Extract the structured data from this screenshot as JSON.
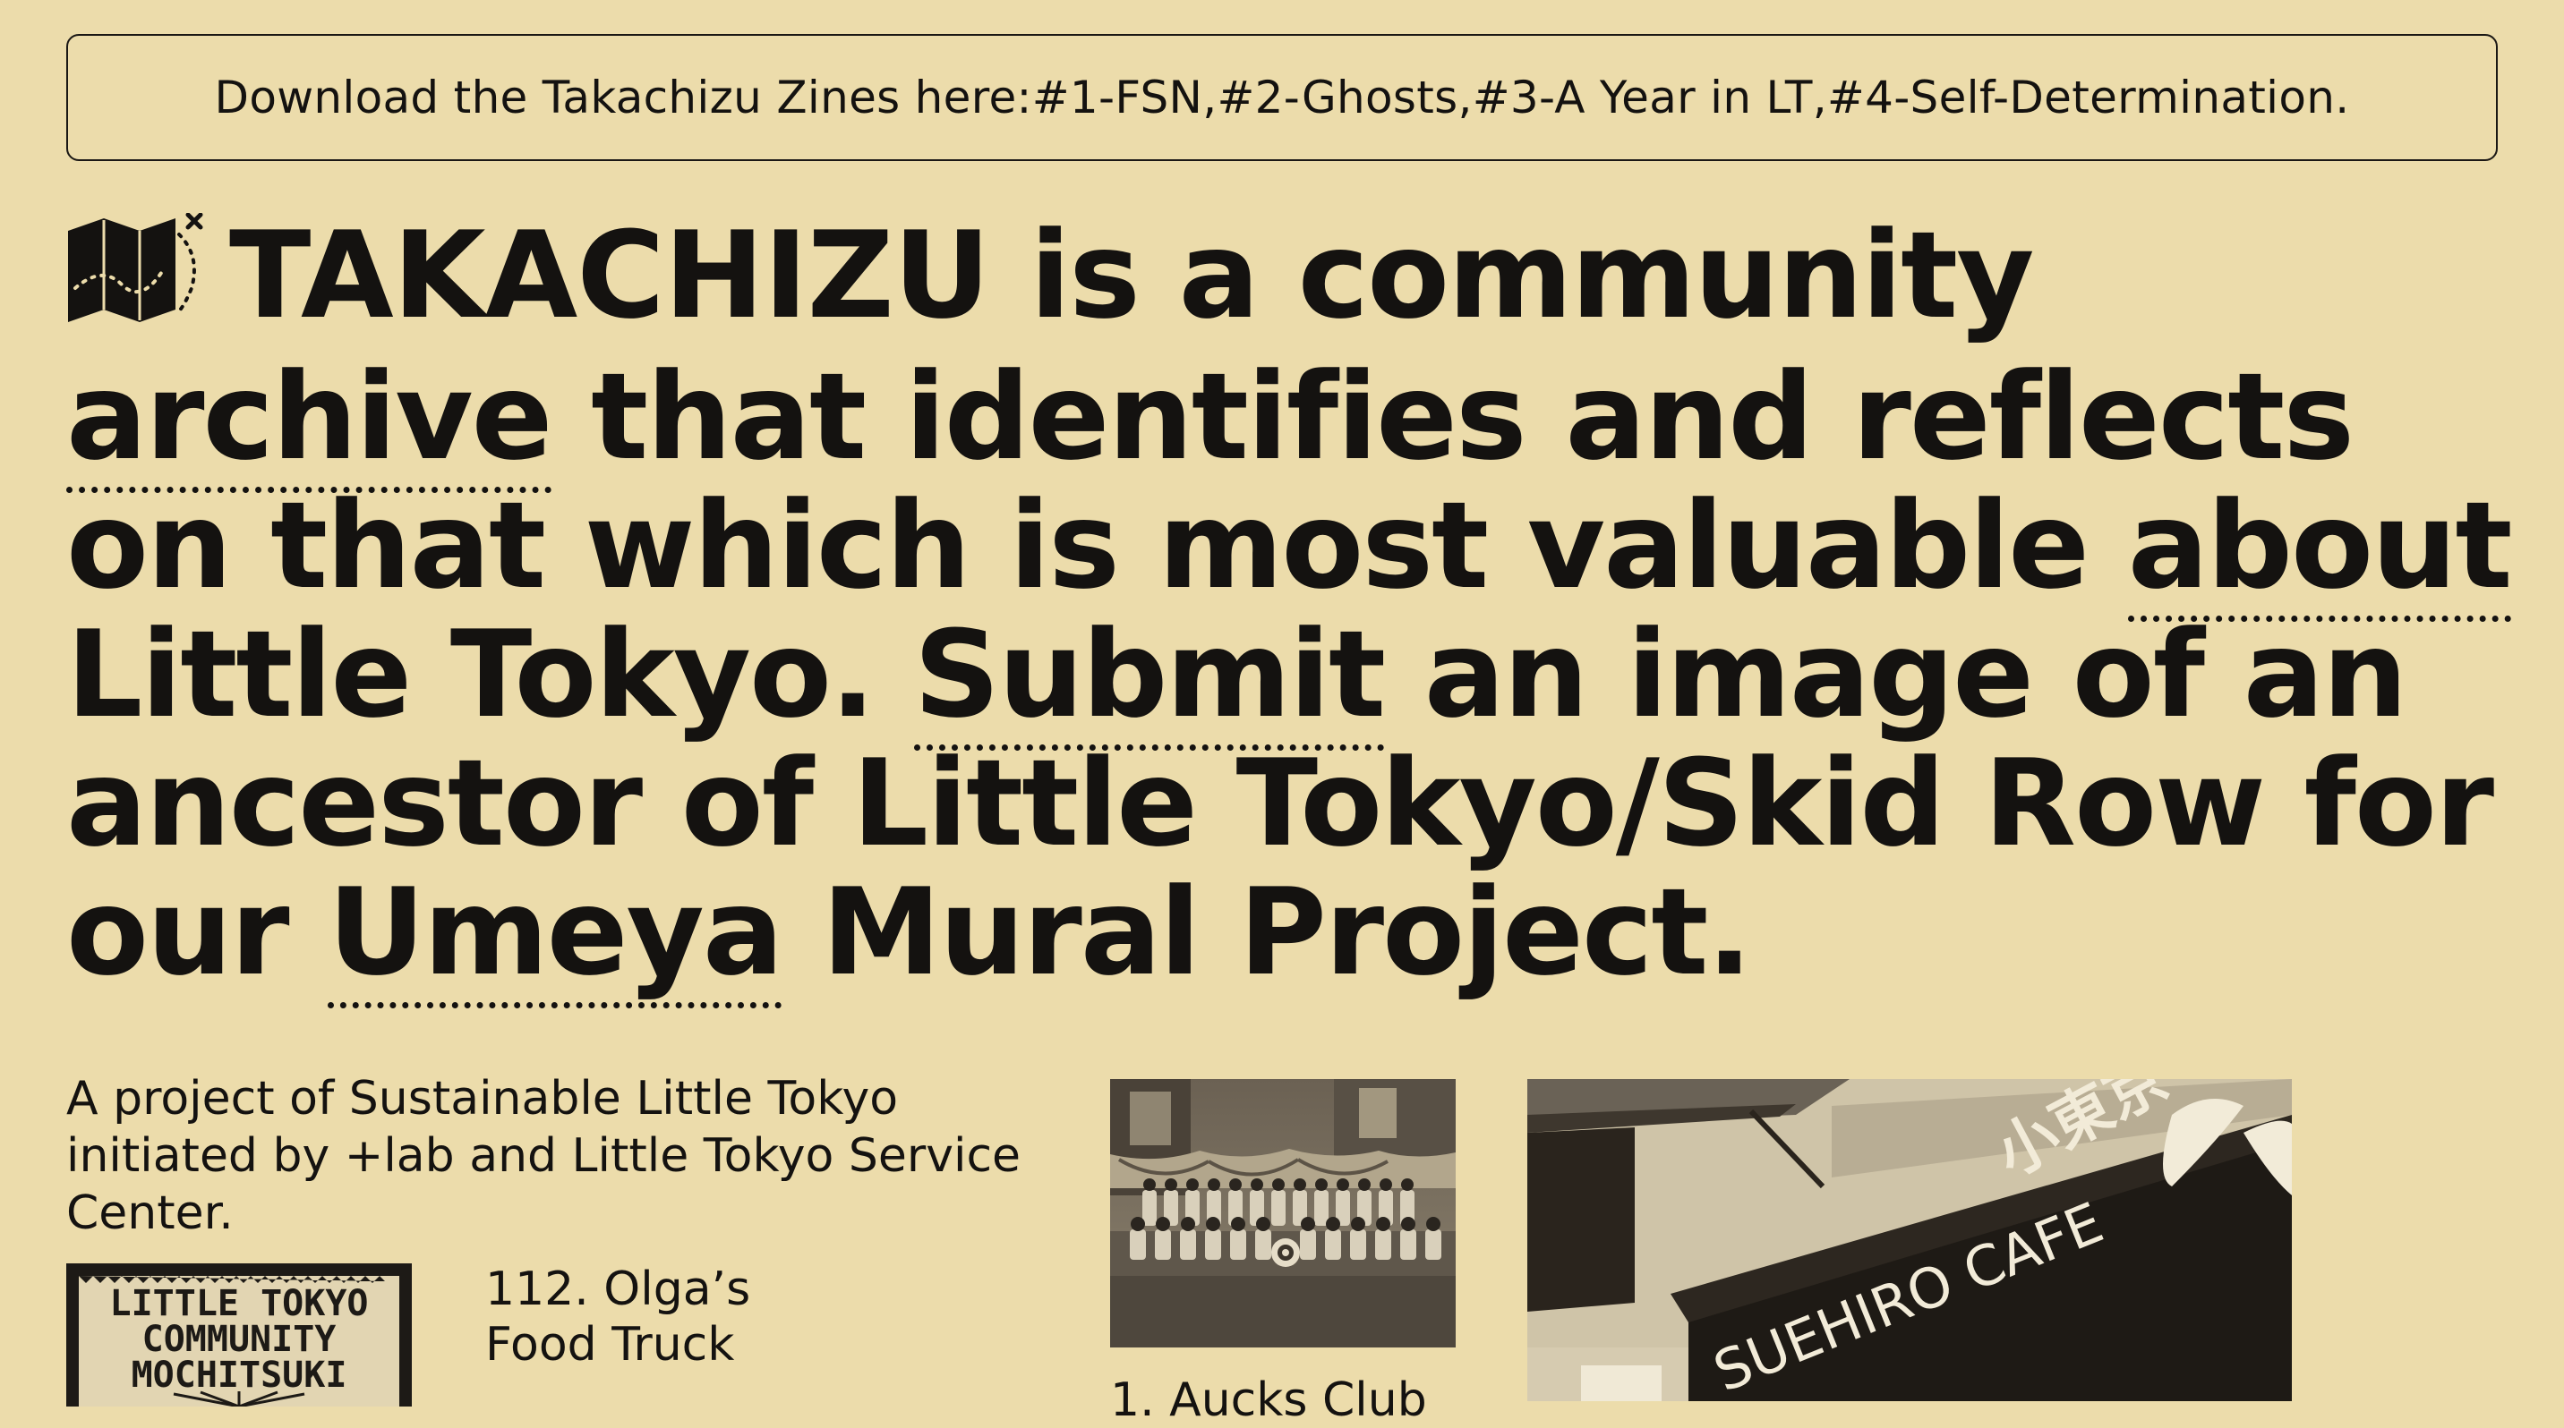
{
  "banner": {
    "prefix": "Download the Takachizu Zines here: ",
    "links": [
      "#1-FSN",
      "#2-Ghosts",
      "#3-A Year in LT",
      "#4-Self-Determination"
    ],
    "sep": " , ",
    "suffix": "."
  },
  "headline": {
    "brand": "TAKACHIZU",
    "t1": " is a community ",
    "archive": "archive",
    "t2": " that identifies and reflects on that which is most valuable ",
    "about": "about",
    "t3": " Little Tokyo. ",
    "submit": "Submit",
    "t4": " an image of an ancestor of Little Tokyo/Skid Row for our ",
    "umeya": "Umeya",
    "t5": " Mural Project."
  },
  "intro": "A project of Sustainable Little Tokyo initiated by +lab and Little Tokyo Service Center.",
  "items": [
    {
      "title": "112. Olga’s Food Truck",
      "image": "Little Tokyo Community Mochitsuki logo",
      "logo_lines": [
        "LITTLE TOKYO",
        "COMMUNITY",
        "MOCHITSUKI"
      ]
    },
    {
      "title": "1. Aucks Club",
      "image": "historic team photo"
    },
    {
      "image": "Suehiro Cafe storefront",
      "sign_text": "SUEHIRO CAFE",
      "sign_kanji": "小東京"
    }
  ],
  "colors": {
    "background": "#ecdcab",
    "ink": "#141210",
    "sepia_dark": "#3a332a",
    "sepia_light": "#cfc2a2"
  }
}
